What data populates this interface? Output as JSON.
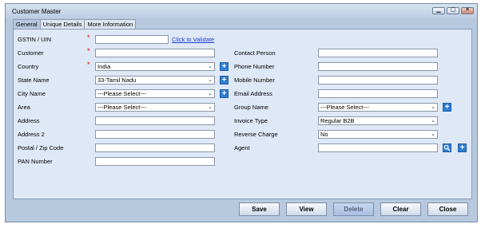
{
  "window": {
    "title": "Customer Master"
  },
  "tabs": [
    {
      "label": "General",
      "active": true
    },
    {
      "label": "Unique Details",
      "active": false
    },
    {
      "label": "More Information",
      "active": false
    }
  ],
  "left_form": {
    "gstin_label": "GSTIN / UIN",
    "gstin_value": "",
    "validate_link": "Click to Validate",
    "customer_label": "Customer",
    "customer_value": "",
    "country_label": "Country",
    "country_value": "India",
    "state_label": "State Name",
    "state_value": "33-Tamil Nadu",
    "city_label": "City Name",
    "city_value": "---Please Select---",
    "area_label": "Area",
    "area_value": "---Please Select---",
    "address_label": "Address",
    "address_value": "",
    "address2_label": "Address 2",
    "address2_value": "",
    "postal_label": "Postal  / Zip Code",
    "postal_value": "",
    "pan_label": "PAN Number",
    "pan_value": ""
  },
  "right_form": {
    "contact_label": "Contact Person",
    "contact_value": "",
    "phone_label": "Phone Number",
    "phone_value": "",
    "mobile_label": "Mobile Number",
    "mobile_value": "",
    "email_label": "Email Address",
    "email_value": "",
    "group_label": "Group Name",
    "group_value": "---Please Select---",
    "invoice_label": "Invoice Type",
    "invoice_value": "Regular B2B",
    "reverse_label": "Reverse Charge",
    "reverse_value": "No",
    "agent_label": "Agent",
    "agent_value": ""
  },
  "required_mark": "*",
  "buttons": {
    "save": "Save",
    "view": "View",
    "delete": "Delete",
    "clear": "Clear",
    "close": "Close"
  },
  "icons": {
    "add": "plus-icon",
    "search": "search-icon",
    "dropdown": "chevron-down-icon"
  },
  "colors": {
    "window_bg": "#b7c9df",
    "panel_bg": "#dfe8f6",
    "add_button": "#2f7fd0",
    "required": "#dd0000",
    "link": "#1a3fd6"
  }
}
